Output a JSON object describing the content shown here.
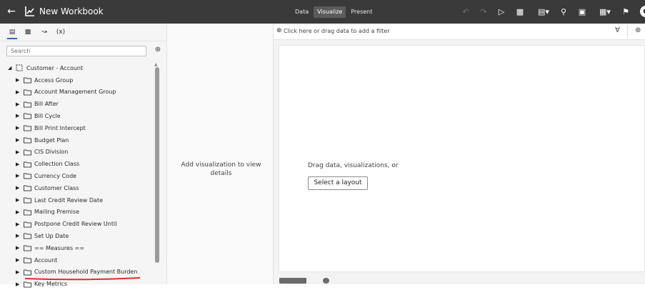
{
  "header": {
    "back_icon": "back-arrow-icon",
    "title": "New Workbook",
    "modes": [
      "Data",
      "Visualize",
      "Present"
    ],
    "active_mode": "Visualize"
  },
  "left_panel": {
    "tabs": [
      "data-icon",
      "chart-icon",
      "trend-icon",
      "(x)"
    ],
    "search_placeholder": "Search",
    "tree_root": "Customer - Account",
    "items": [
      "Access Group",
      "Account Management Group",
      "Bill After",
      "Bill Cycle",
      "Bill Print Intercept",
      "Budget Plan",
      "CIS Division",
      "Collection Class",
      "Currency Code",
      "Customer Class",
      "Last Credit Review Date",
      "Mailing Premise",
      "Postpone Credit Review Until",
      "Set Up Date",
      "== Measures ==",
      "Account",
      "Custom Household Payment Burden",
      "Key Metrics"
    ]
  },
  "middle_panel": {
    "message": "Add visualization to view details"
  },
  "filter_bar": {
    "placeholder": "Click here or drag data to add a filter"
  },
  "canvas": {
    "message": "Drag data, visualizations, or",
    "layout_button": "Select a layout"
  },
  "colors": {
    "topbar": "#3a3a3a",
    "annotation_underline": "#d9302c"
  }
}
